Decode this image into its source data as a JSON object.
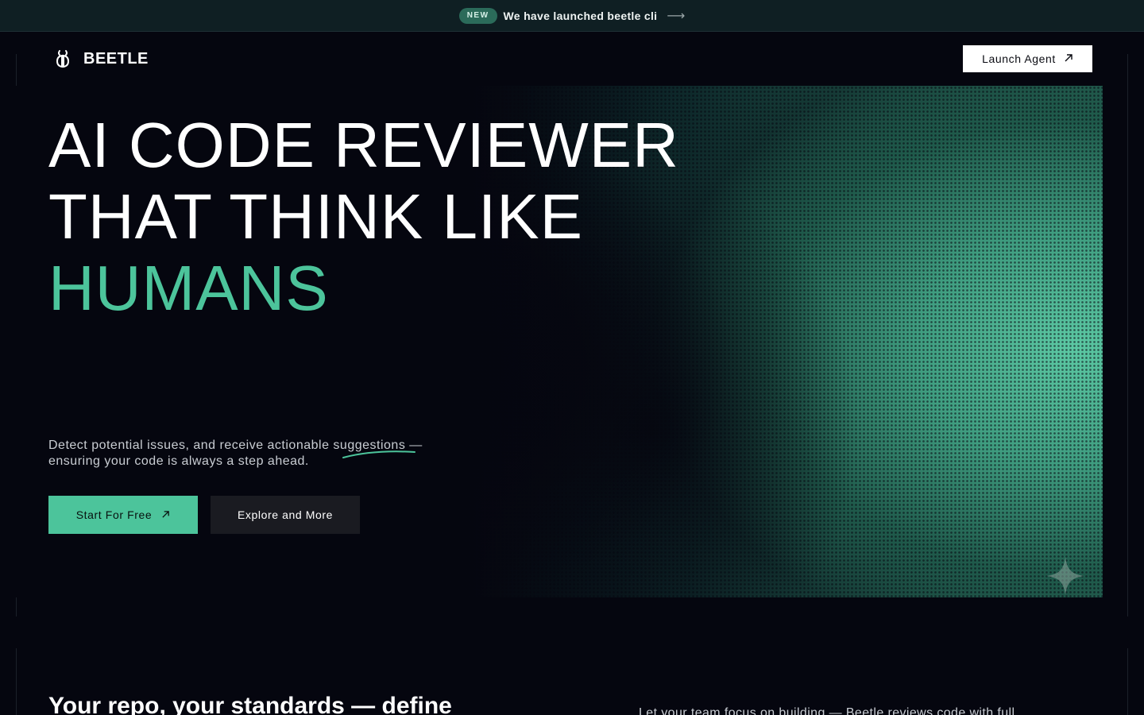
{
  "announcement": {
    "badge": "NEW",
    "text": "We have launched beetle cli",
    "arrow": "⟶"
  },
  "header": {
    "logo_text": "BEETLE",
    "logo_icon": "beetle-icon",
    "launch_label": "Launch Agent",
    "launch_icon": "arrow-up-right-icon"
  },
  "hero": {
    "headline_line1": "AI CODE REVIEWER",
    "headline_line2": "THAT THINK LIKE",
    "headline_accent": "HUMANS",
    "description_part1": "Detect potential issues, and receive actionable ",
    "description_highlight": "suggestions",
    "description_part2": " — ensuring your code is always a step ahead.",
    "primary_cta": "Start For Free",
    "secondary_cta": "Explore and More",
    "accent_color": "#4cc49b"
  },
  "next_section": {
    "title": "Your repo, your standards — define",
    "text": "Let your team focus on building — Beetle reviews code with full"
  }
}
